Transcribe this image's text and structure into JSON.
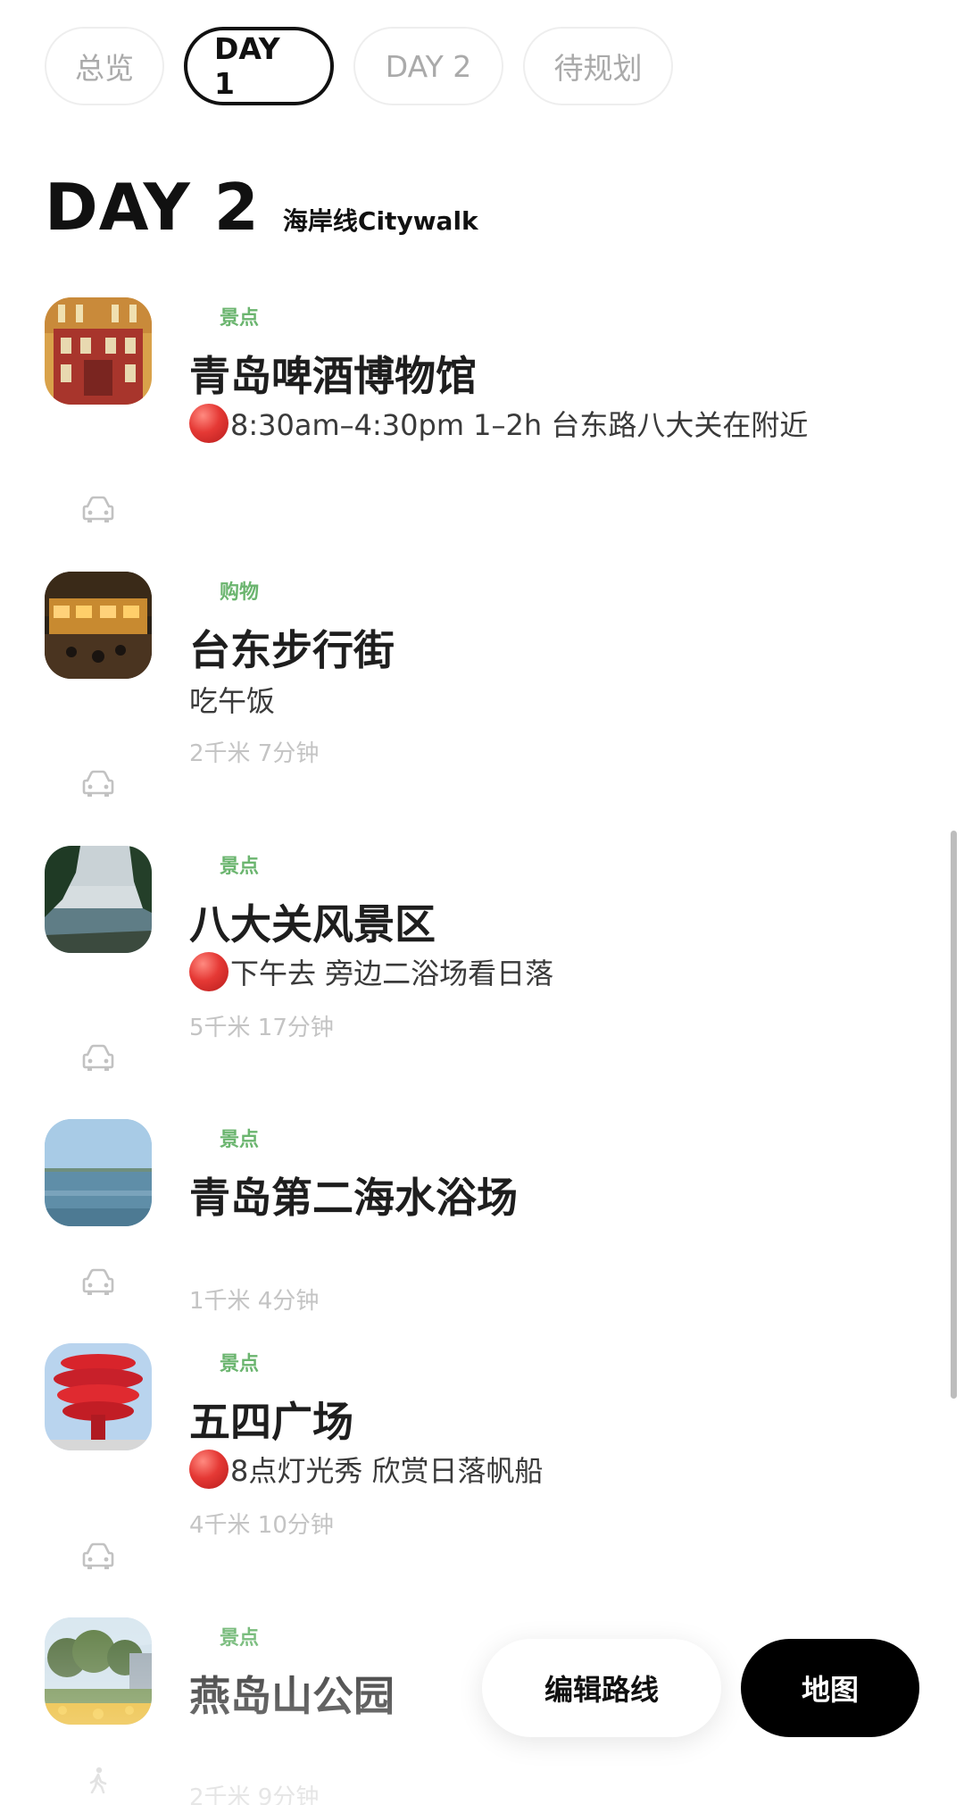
{
  "tabs": [
    {
      "label": "总览"
    },
    {
      "label": "DAY 1"
    },
    {
      "label": "DAY 2"
    },
    {
      "label": "待规划"
    }
  ],
  "day": {
    "title": "DAY 2",
    "subtitle": "海岸线Citywalk"
  },
  "items": [
    {
      "tag": "景点",
      "name": "青岛啤酒博物馆",
      "note": "8:30am–4:30pm 1–2h 台东路八大关在附近",
      "has_dot": true,
      "distance": "",
      "connector": "car-icon"
    },
    {
      "tag": "购物",
      "name": "台东步行街",
      "note": "吃午饭",
      "has_dot": false,
      "distance": "2千米 7分钟",
      "connector": "car-icon"
    },
    {
      "tag": "景点",
      "name": "八大关风景区",
      "note": "下午去 旁边二浴场看日落",
      "has_dot": true,
      "distance": "5千米 17分钟",
      "connector": "car-icon"
    },
    {
      "tag": "景点",
      "name": "青岛第二海水浴场",
      "note": "",
      "has_dot": false,
      "distance": "1千米 4分钟",
      "connector": "car-icon"
    },
    {
      "tag": "景点",
      "name": "五四广场",
      "note": "8点灯光秀 欣赏日落帆船",
      "has_dot": true,
      "distance": "4千米 10分钟",
      "connector": "car-icon"
    },
    {
      "tag": "景点",
      "name": "燕岛山公园",
      "note": "",
      "has_dot": false,
      "distance": "2千米 9分钟",
      "connector": "walk-icon"
    }
  ],
  "actions": {
    "edit_route": "编辑路线",
    "map": "地图"
  },
  "colors": {
    "tag_green": "#6bb56f",
    "active_tab_border": "#111111",
    "map_button": "#000000",
    "status_dot": "#e53935"
  }
}
